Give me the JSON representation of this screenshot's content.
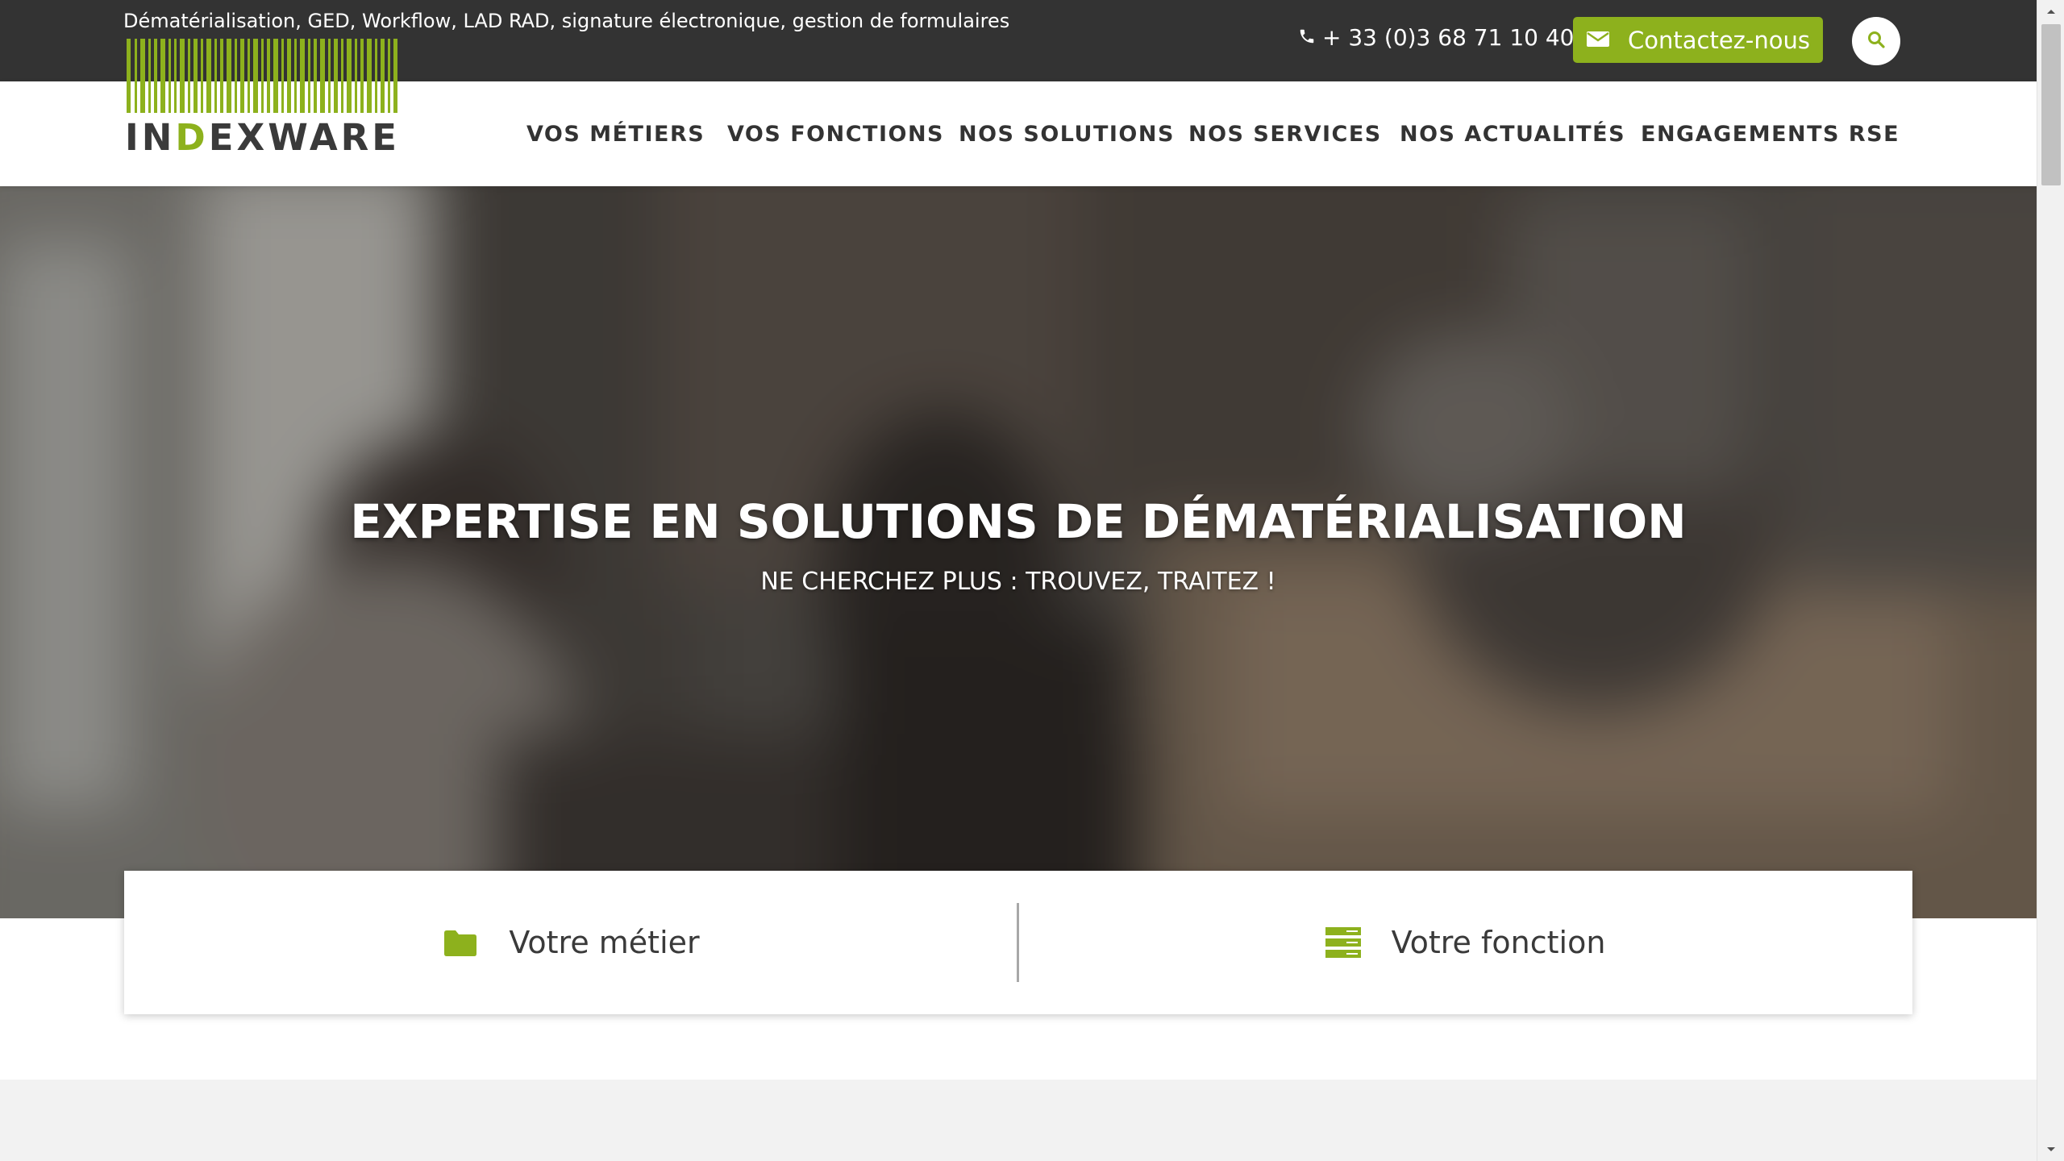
{
  "topbar": {
    "tagline": "Dématérialisation, GED, Workflow, LAD RAD, signature électronique, gestion de formulaires",
    "phone": "+ 33 (0)3 68 71 10 40",
    "contact_label": "Contactez-nous",
    "background": "#333333"
  },
  "brand": {
    "name_prefix": "IN",
    "name_accent": "D",
    "name_suffix": "EXWARE",
    "accent_color": "#8db11d"
  },
  "nav": {
    "items": [
      {
        "label": "VOS MÉTIERS"
      },
      {
        "label": "VOS FONCTIONS"
      },
      {
        "label": "NOS SOLUTIONS"
      },
      {
        "label": "NOS SERVICES"
      },
      {
        "label": "NOS ACTUALITÉS"
      },
      {
        "label": "ENGAGEMENTS RSE"
      }
    ]
  },
  "hero": {
    "title": "EXPERTISE EN SOLUTIONS DE DÉMATÉRIALISATION",
    "subtitle": "NE CHERCHEZ PLUS : TROUVEZ, TRAITEZ !"
  },
  "choices": {
    "left": {
      "label": "Votre métier",
      "icon": "folder-icon"
    },
    "right": {
      "label": "Votre fonction",
      "icon": "server-icon"
    }
  },
  "icons": {
    "phone": "phone-icon",
    "contact": "envelope-icon",
    "search": "search-icon"
  }
}
